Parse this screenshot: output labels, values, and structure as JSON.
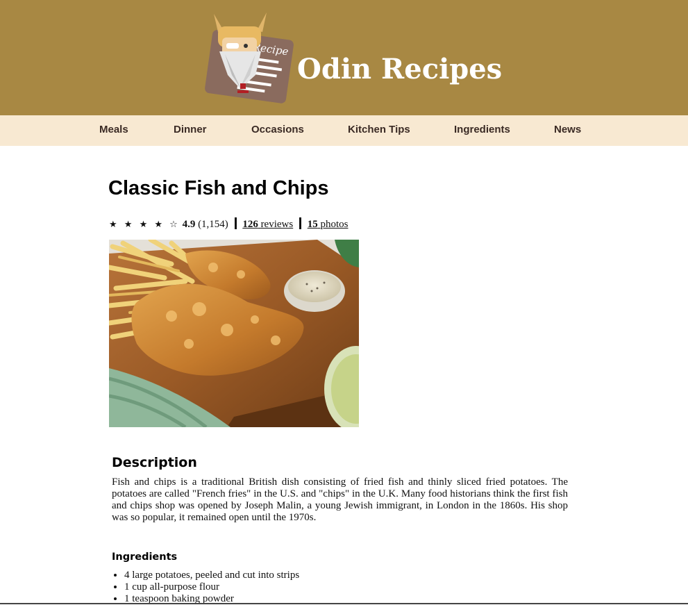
{
  "header": {
    "site_title": "Odin Recipes",
    "logo_text": "Recipe",
    "background_color": "#a88843"
  },
  "nav": {
    "background_color": "#f8e9d2",
    "items": [
      {
        "label": "Meals"
      },
      {
        "label": "Dinner"
      },
      {
        "label": "Occasions"
      },
      {
        "label": "Kitchen Tips"
      },
      {
        "label": "Ingredients"
      },
      {
        "label": "News"
      }
    ]
  },
  "recipe": {
    "title": "Classic Fish and Chips",
    "rating": {
      "stars": "★ ★ ★ ★ ☆",
      "average": "4.9",
      "count": "(1,154)",
      "reviews_number": "126",
      "reviews_label": "reviews",
      "photos_number": "15",
      "photos_label": "photos"
    },
    "hero_image": "fish-and-chips-photo",
    "description": {
      "heading": "Description",
      "text": "Fish and chips is a traditional British dish consisting of fried fish and thinly sliced fried potatoes. The potatoes are called \"French fries\" in the U.S. and \"chips\" in the U.K. Many food historians think the first fish and chips shop was opened by Joseph Malin, a young Jewish immigrant, in London in the 1860s. His shop was so popular, it remained open until the 1970s."
    },
    "ingredients": {
      "heading": "Ingredients",
      "items": [
        "4 large potatoes, peeled and cut into strips",
        "1 cup all-purpose flour",
        "1 teaspoon baking powder"
      ]
    }
  }
}
